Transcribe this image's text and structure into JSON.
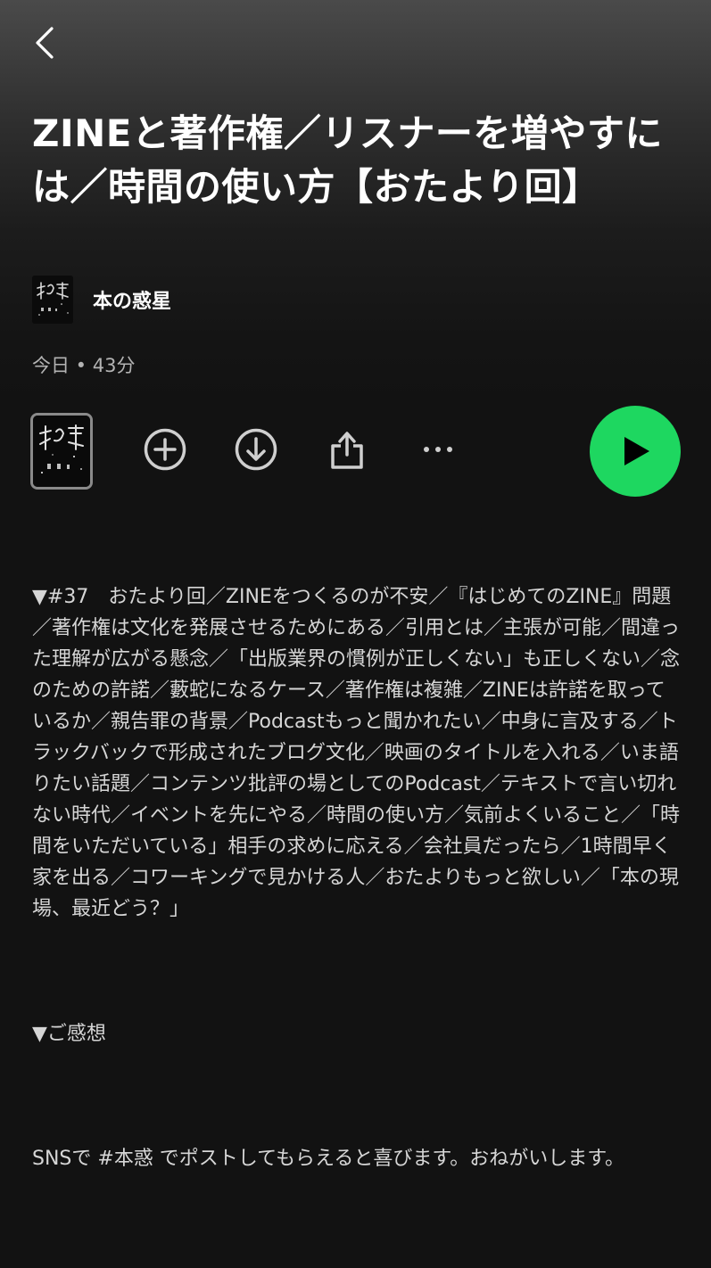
{
  "header": {
    "back_icon": "chevron-left-icon"
  },
  "episode": {
    "title": "ZINEと著作権／リスナーを増やすには／時間の使い方【おたより回】",
    "show_name": "本の惑星",
    "meta": "今日 • 43分"
  },
  "actions": {
    "add_icon": "plus-circle-icon",
    "download_icon": "download-circle-icon",
    "share_icon": "share-icon",
    "more_icon": "more-horizontal-icon",
    "play_icon": "play-icon"
  },
  "description": {
    "main": "▼#37　おたより回／ZINEをつくるのが不安／『はじめてのZINE』問題／著作権は文化を発展させるためにある／引用とは／主張が可能／間違った理解が広がる懸念／「出版業界の慣例が正しくない」も正しくない／念のための許諾／藪蛇になるケース／著作権は複雑／ZINEは許諾を取っているか／親告罪の背景／Podcastもっと聞かれたい／中身に言及する／トラックバックで形成されたブログ文化／映画のタイトルを入れる／いま語りたい話題／コンテンツ批評の場としてのPodcast／テキストで言い切れない時代／イベントを先にやる／時間の使い方／気前よくいること／「時間をいただいている」相手の求めに応える／会社員だったら／1時間早く家を出る／コワーキングで見かける人／おたよりもっと欲しい／「本の現場、最近どう？」",
    "section_heading": "▼ご感想",
    "cta": "SNSで #本惑 でポストしてもらえると喜びます。おねがいします。"
  },
  "colors": {
    "background": "#121212",
    "accent": "#1ed760",
    "secondary_text": "#b3b3b3"
  }
}
